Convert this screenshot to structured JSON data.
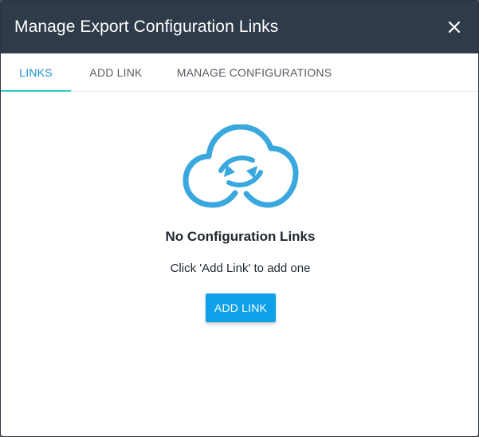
{
  "dialog": {
    "title": "Manage Export Configuration Links",
    "close_icon": "close-icon"
  },
  "tabs": [
    {
      "label": "LINKS",
      "active": true
    },
    {
      "label": "ADD LINK",
      "active": false
    },
    {
      "label": "MANAGE CONFIGURATIONS",
      "active": false
    }
  ],
  "empty_state": {
    "icon": "cloud-sync-icon",
    "title": "No Configuration Links",
    "subtitle": "Click 'Add Link' to add one",
    "button_label": "ADD LINK"
  },
  "colors": {
    "header_bg": "#2f3b49",
    "active_tab_text": "#1a8fcf",
    "active_tab_indicator": "#36c6b8",
    "primary_button": "#0ea0e8",
    "icon_color": "#3aa8de"
  }
}
